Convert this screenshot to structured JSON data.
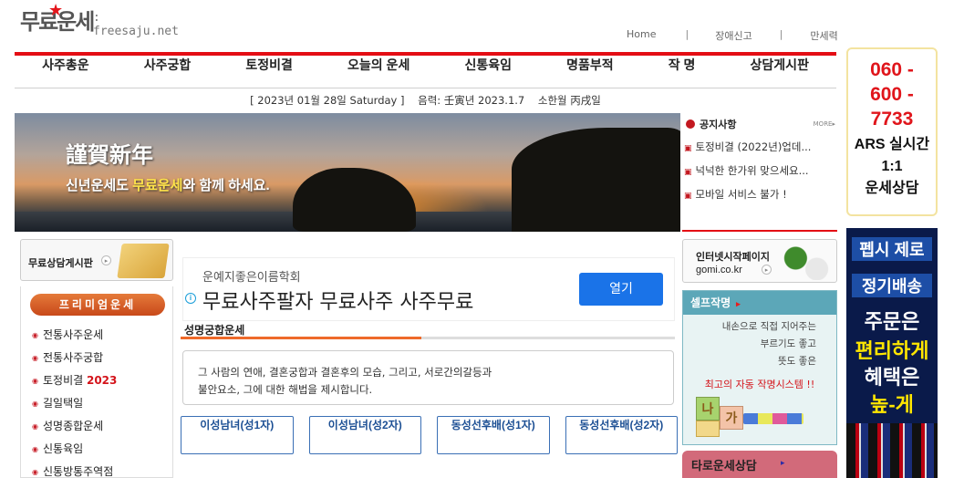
{
  "logo": {
    "mark": "무료운세",
    "domain": ": freesaju.net"
  },
  "toplinks": [
    "Home",
    "장애신고",
    "만세력"
  ],
  "nav": [
    "사주총운",
    "사주궁합",
    "토정비결",
    "오늘의 운세",
    "신통육임",
    "명품부적",
    "작 명",
    "상담게시판"
  ],
  "datebar": "[ 2023년 01월 28일 Saturday ]    음력: 壬寅년 2023.1.7    소한월 丙戌일",
  "banner": {
    "title": "謹賀新年",
    "sub_prefix": "신년운세도 ",
    "sub_highlight": "무료운세",
    "sub_suffix": "와 함께 하세요."
  },
  "notice": {
    "title": "공지사항",
    "more": "MORE▸",
    "items": [
      "토정비결 (2022년)업데...",
      "넉넉한 한가위 맞으세요...",
      "모바일 서비스 불가 !"
    ]
  },
  "ars": {
    "number_lines": [
      "060 -",
      "600 -",
      "7733"
    ],
    "text_lines": [
      "ARS 실시간",
      "1:1",
      "운세상담"
    ]
  },
  "sidead": {
    "l1": "펩시 제로",
    "l2": "정기배송",
    "l3": "주문은",
    "l4": "편리하게",
    "l5": "혜택은",
    "l6": "높-게"
  },
  "freeboard": {
    "label": "무료상담게시판",
    "arrow": "▸"
  },
  "premium": {
    "title": "프리미엄운세",
    "items": [
      {
        "label": "전통사주운세",
        "extra": ""
      },
      {
        "label": "전통사주궁합",
        "extra": ""
      },
      {
        "label": "토정비결 ",
        "extra": "2023"
      },
      {
        "label": "길일택일",
        "extra": ""
      },
      {
        "label": "성명종합운세",
        "extra": ""
      },
      {
        "label": "신통육임",
        "extra": ""
      },
      {
        "label": "신통방통주역점",
        "extra": ""
      }
    ]
  },
  "ad": {
    "org": "운예지좋은이름학회",
    "headline": "무료사주팔자 무료사주 사주무료",
    "open_label": "열기",
    "info": "i"
  },
  "section": {
    "title": "성명궁합운세",
    "desc_line1": "그 사람의 연애, 결혼궁합과 결혼후의 모습, 그리고, 서로간의갈등과",
    "desc_line2": "불안요소, 그에 대한 해법을 제시합니다.",
    "buttons": [
      "이성남녀(성1자)",
      "이성남녀(성2자)",
      "동성선후배(성1자)",
      "동성선후배(성2자)"
    ]
  },
  "startpage": {
    "line1": "인터넷시작페이지",
    "line2": "gomi.co.kr",
    "arrow": "▸"
  },
  "selfname": {
    "title": "셀프작명",
    "arrow": "▸",
    "lines": [
      "내손으로 직접 지어주는",
      "부르기도 좋고",
      "뜻도 좋은"
    ],
    "cta": "최고의 자동 작명시스템 !!",
    "block1": "나",
    "block2": "가"
  },
  "tarot": {
    "title": "타로운세상담",
    "arrow": "▸"
  },
  "colors": {
    "accent_red": "#e40d14",
    "link_blue": "#1c4f94",
    "ad_button": "#1a73e8",
    "teal": "#5ca7b8"
  }
}
